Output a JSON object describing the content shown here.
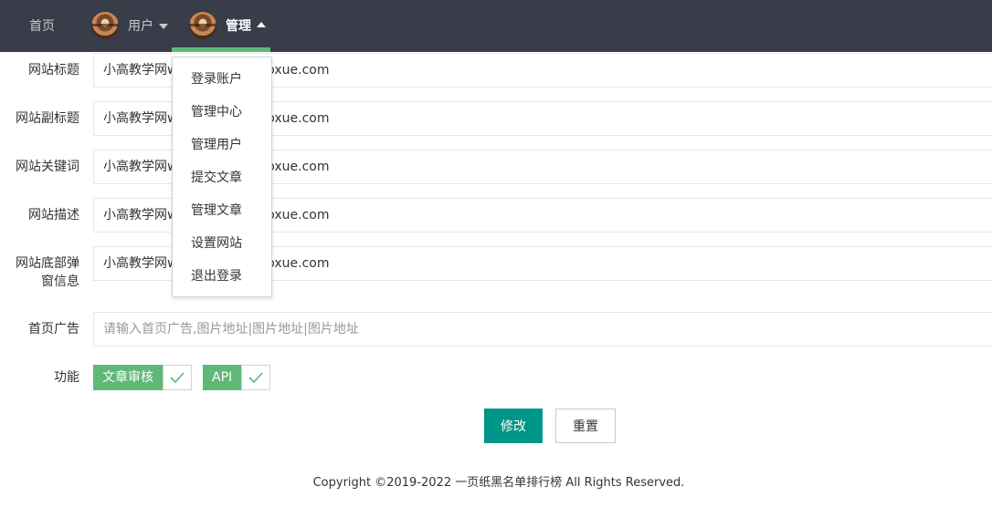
{
  "nav": {
    "home": "首页",
    "user": "用户",
    "admin": "管理"
  },
  "dropdown": {
    "items": [
      "登录账户",
      "管理中心",
      "管理用户",
      "提交文章",
      "管理文章",
      "设置网站",
      "退出登录"
    ]
  },
  "form": {
    "site_title": {
      "label": "网站标题",
      "value": "小高教学网www.xiaogaojiaoxue.com"
    },
    "site_subtitle": {
      "label": "网站副标题",
      "value": "小高教学网www.xiaogaojiaoxue.com"
    },
    "site_keywords": {
      "label": "网站关键词",
      "value": "小高教学网www.xiaogaojiaoxue.com"
    },
    "site_description": {
      "label": "网站描述",
      "value": "小高教学网www.xiaogaojiaoxue.com"
    },
    "site_footer_popup": {
      "label_line1": "网站底部弹",
      "label_line2": "窗信息",
      "value": "小高教学网www.xiaogaojiaoxue.com"
    },
    "home_ad": {
      "label": "首页广告",
      "placeholder": "请输入首页广告,图片地址|图片地址|图片地址"
    },
    "features": {
      "label": "功能",
      "items": [
        {
          "name": "文章审核",
          "checked": true
        },
        {
          "name": "API",
          "checked": true
        }
      ]
    }
  },
  "buttons": {
    "submit": "修改",
    "reset": "重置"
  },
  "footer": {
    "copyright": "Copyright ©2019-2022 一页纸黑名单排行榜 All Rights Reserved."
  },
  "colors": {
    "topbar": "#393D49",
    "accent": "#5FB878",
    "primary_button": "#009688"
  }
}
